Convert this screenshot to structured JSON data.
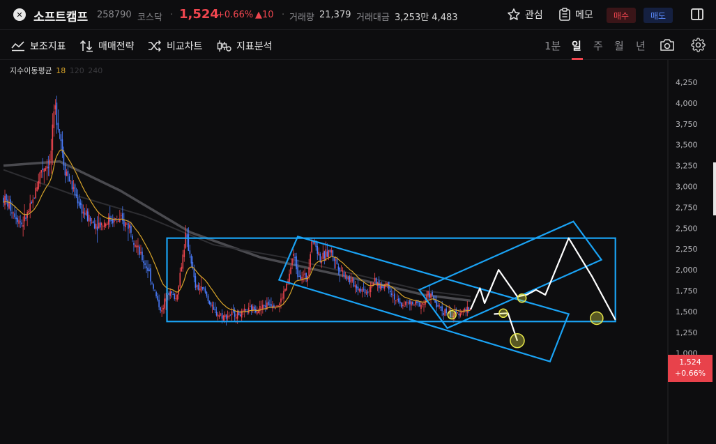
{
  "header": {
    "stock_name": "소프트캠프",
    "stock_code": "258790",
    "market": "코스닥",
    "price": "1,524",
    "change_pct": "+0.66%",
    "change_abs": "▲10",
    "volume_label": "거래량",
    "volume_value": "21,379",
    "amount_label": "거래대금",
    "amount_value": "3,253만 4,483",
    "watch_label": "관심",
    "memo_label": "메모",
    "buy_label": "매수",
    "sell_label": "매도"
  },
  "toolbar": {
    "indicators_label": "보조지표",
    "strategy_label": "매매전략",
    "compare_label": "비교차트",
    "analysis_label": "지표분석",
    "timeframes": [
      "1분",
      "일",
      "주",
      "월",
      "년"
    ],
    "active_timeframe": "일"
  },
  "indicator_legend": {
    "label": "지수이동평균",
    "p1": "18",
    "p2": "120",
    "p3": "240"
  },
  "colors": {
    "up": "#f0464f",
    "down": "#4a7dff",
    "ma18": "#d9a52a",
    "drawing": "#1aa3f5",
    "marker": "#e6e64a"
  },
  "chart_data": {
    "type": "candlestick",
    "y_ticks": [
      "4,250",
      "4,000",
      "3,750",
      "3,500",
      "3,250",
      "3,000",
      "2,750",
      "2,500",
      "2,250",
      "2,000",
      "1,750",
      "1,500",
      "1,250",
      "1,000"
    ],
    "ylim": [
      900,
      4350
    ],
    "current_price_label": "1,524",
    "current_change_label": "+0.66%",
    "price_path": [
      [
        0,
        2860
      ],
      [
        2,
        2710
      ],
      [
        4,
        2550
      ],
      [
        6,
        2760
      ],
      [
        8,
        3200
      ],
      [
        10,
        3300
      ],
      [
        11,
        3950
      ],
      [
        12,
        3700
      ],
      [
        13,
        3250
      ],
      [
        15,
        2950
      ],
      [
        17,
        2700
      ],
      [
        19,
        2560
      ],
      [
        21,
        2550
      ],
      [
        23,
        2610
      ],
      [
        25,
        2580
      ],
      [
        27,
        2530
      ],
      [
        29,
        2200
      ],
      [
        31,
        2000
      ],
      [
        33,
        1620
      ],
      [
        34,
        1480
      ],
      [
        35,
        1760
      ],
      [
        37,
        1650
      ],
      [
        39,
        2400
      ],
      [
        40,
        2180
      ],
      [
        41,
        1800
      ],
      [
        43,
        1750
      ],
      [
        45,
        1500
      ],
      [
        47,
        1440
      ],
      [
        49,
        1470
      ],
      [
        51,
        1470
      ],
      [
        53,
        1530
      ],
      [
        55,
        1540
      ],
      [
        57,
        1600
      ],
      [
        59,
        1580
      ],
      [
        61,
        1870
      ],
      [
        62,
        2200
      ],
      [
        63,
        1960
      ],
      [
        65,
        1900
      ],
      [
        66,
        2380
      ],
      [
        67,
        2270
      ],
      [
        68,
        2110
      ],
      [
        69,
        2190
      ],
      [
        70,
        2230
      ],
      [
        71,
        2110
      ],
      [
        72,
        2020
      ],
      [
        74,
        1880
      ],
      [
        76,
        1780
      ],
      [
        78,
        1740
      ],
      [
        79,
        1860
      ],
      [
        81,
        1790
      ],
      [
        82,
        1850
      ],
      [
        83,
        1740
      ],
      [
        84,
        1640
      ],
      [
        85,
        1570
      ],
      [
        86,
        1600
      ],
      [
        88,
        1580
      ],
      [
        90,
        1600
      ],
      [
        91,
        1720
      ],
      [
        92,
        1650
      ],
      [
        93,
        1560
      ],
      [
        94,
        1510
      ],
      [
        95,
        1490
      ],
      [
        96,
        1450
      ],
      [
        97,
        1470
      ],
      [
        98,
        1510
      ],
      [
        100,
        1524
      ]
    ],
    "ma120_path": [
      [
        0,
        3200
      ],
      [
        15,
        2900
      ],
      [
        30,
        2650
      ],
      [
        45,
        2300
      ],
      [
        60,
        2150
      ],
      [
        75,
        1950
      ],
      [
        90,
        1750
      ],
      [
        100,
        1680
      ]
    ],
    "ma240_path": [
      [
        0,
        3250
      ],
      [
        12,
        3300
      ],
      [
        25,
        2950
      ],
      [
        40,
        2450
      ],
      [
        55,
        2150
      ],
      [
        75,
        1900
      ],
      [
        90,
        1700
      ],
      [
        100,
        1630
      ]
    ],
    "projection_path": [
      [
        100,
        1524
      ],
      [
        102,
        1780
      ],
      [
        103,
        1600
      ],
      [
        106,
        2000
      ],
      [
        110,
        1680
      ],
      [
        112,
        1700
      ],
      [
        114,
        1760
      ],
      [
        116,
        1700
      ],
      [
        121,
        2380
      ],
      [
        126,
        1920
      ],
      [
        131,
        1400
      ]
    ],
    "projection_path2": [
      [
        105,
        1470
      ],
      [
        108,
        1480
      ],
      [
        110,
        1150
      ]
    ],
    "rect_box": [
      [
        35,
        2380
      ],
      [
        131,
        1380
      ]
    ],
    "channel_down": [
      [
        59,
        1880
      ],
      [
        63,
        2400
      ],
      [
        121,
        1470
      ],
      [
        117,
        900
      ]
    ],
    "channel_up": [
      [
        89,
        1760
      ],
      [
        95,
        1300
      ],
      [
        128,
        2120
      ],
      [
        122,
        2580
      ]
    ],
    "marker_points": [
      [
        96,
        1460
      ],
      [
        107,
        1480
      ],
      [
        110,
        1150
      ],
      [
        111,
        1660
      ],
      [
        127,
        1420
      ]
    ]
  }
}
